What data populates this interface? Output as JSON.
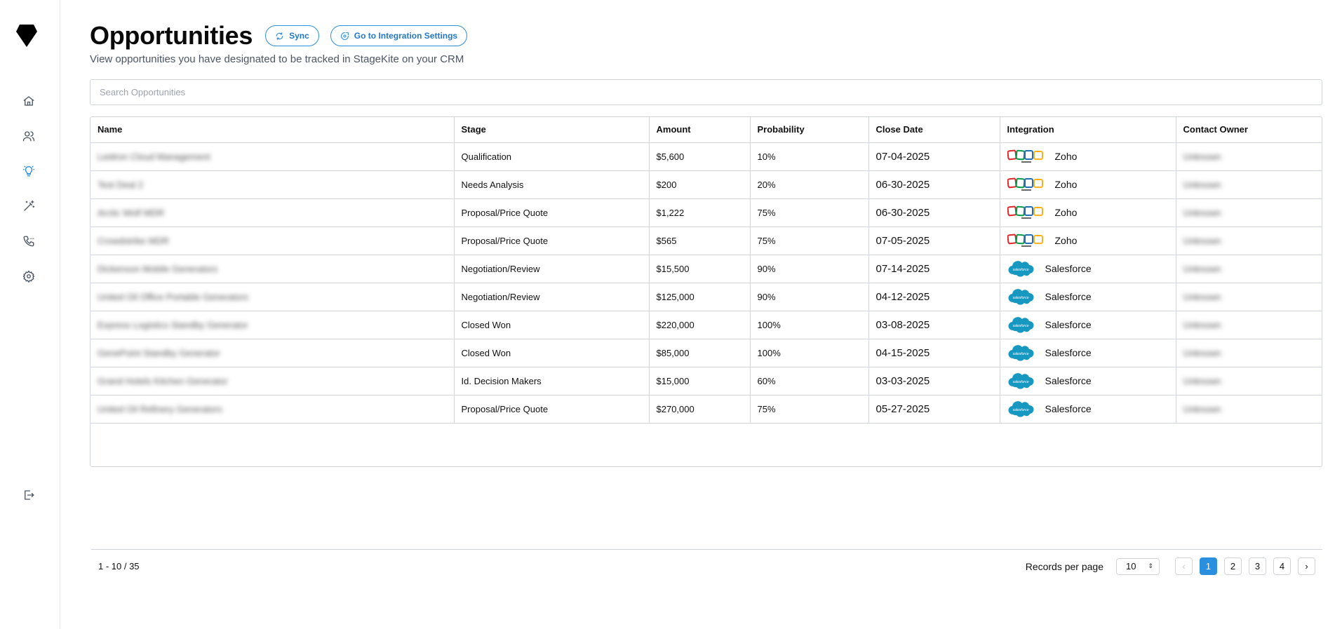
{
  "sidebar": {
    "logo_icon": "diamond-logo-icon",
    "items": [
      {
        "name": "home",
        "icon": "home-icon"
      },
      {
        "name": "contacts",
        "icon": "users-icon"
      },
      {
        "name": "opportunities",
        "icon": "lightbulb-icon",
        "active": true
      },
      {
        "name": "magic",
        "icon": "wand-icon"
      },
      {
        "name": "calls",
        "icon": "phone-icon"
      },
      {
        "name": "settings",
        "icon": "gear-icon"
      }
    ],
    "logout_icon": "logout-icon"
  },
  "header": {
    "title": "Opportunities",
    "sync_label": "Sync",
    "integration_settings_label": "Go to Integration Settings",
    "subtitle": "View opportunities you have designated to be tracked in StageKite on your CRM"
  },
  "search": {
    "placeholder": "Search Opportunities",
    "value": ""
  },
  "table": {
    "columns": [
      "Name",
      "Stage",
      "Amount",
      "Probability",
      "Close Date",
      "Integration",
      "Contact Owner"
    ],
    "rows": [
      {
        "name": "Leidron Cloud Management",
        "stage": "Qualification",
        "amount": "$5,600",
        "probability": "10%",
        "close_date": "07-04-2025",
        "integration": "Zoho",
        "owner": "Unknown"
      },
      {
        "name": "Test Deal 2",
        "stage": "Needs Analysis",
        "amount": "$200",
        "probability": "20%",
        "close_date": "06-30-2025",
        "integration": "Zoho",
        "owner": "Unknown"
      },
      {
        "name": "Arctic Wolf MDR",
        "stage": "Proposal/Price Quote",
        "amount": "$1,222",
        "probability": "75%",
        "close_date": "06-30-2025",
        "integration": "Zoho",
        "owner": "Unknown"
      },
      {
        "name": "Crowdstrike MDR",
        "stage": "Proposal/Price Quote",
        "amount": "$565",
        "probability": "75%",
        "close_date": "07-05-2025",
        "integration": "Zoho",
        "owner": "Unknown"
      },
      {
        "name": "Dickenson Mobile Generators",
        "stage": "Negotiation/Review",
        "amount": "$15,500",
        "probability": "90%",
        "close_date": "07-14-2025",
        "integration": "Salesforce",
        "owner": "Unknown"
      },
      {
        "name": "United Oil Office Portable Generators",
        "stage": "Negotiation/Review",
        "amount": "$125,000",
        "probability": "90%",
        "close_date": "04-12-2025",
        "integration": "Salesforce",
        "owner": "Unknown"
      },
      {
        "name": "Express Logistics Standby Generator",
        "stage": "Closed Won",
        "amount": "$220,000",
        "probability": "100%",
        "close_date": "03-08-2025",
        "integration": "Salesforce",
        "owner": "Unknown"
      },
      {
        "name": "GenePoint Standby Generator",
        "stage": "Closed Won",
        "amount": "$85,000",
        "probability": "100%",
        "close_date": "04-15-2025",
        "integration": "Salesforce",
        "owner": "Unknown"
      },
      {
        "name": "Grand Hotels Kitchen Generator",
        "stage": "Id. Decision Makers",
        "amount": "$15,000",
        "probability": "60%",
        "close_date": "03-03-2025",
        "integration": "Salesforce",
        "owner": "Unknown"
      },
      {
        "name": "United Oil Refinery Generators",
        "stage": "Proposal/Price Quote",
        "amount": "$270,000",
        "probability": "75%",
        "close_date": "05-27-2025",
        "integration": "Salesforce",
        "owner": "Unknown"
      }
    ]
  },
  "footer": {
    "range": "1 - 10 / 35",
    "records_per_page_label": "Records per page",
    "records_per_page_value": "10",
    "prev_label": "‹",
    "next_label": "›",
    "pages": [
      "1",
      "2",
      "3",
      "4"
    ],
    "current_page": "1"
  },
  "colors": {
    "accent": "#2b8fe0",
    "border": "#d1d5db",
    "salesforce": "#1798c1"
  }
}
